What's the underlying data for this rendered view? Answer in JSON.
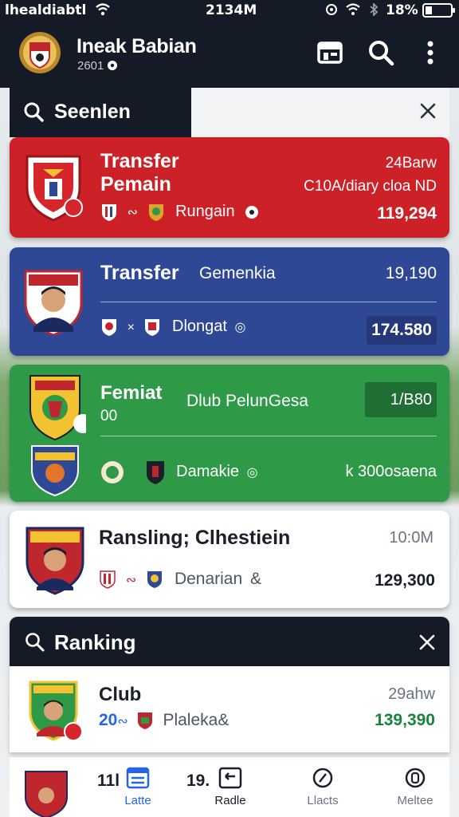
{
  "status": {
    "carrier": "lhealdiabtl",
    "time": "2134M",
    "battery": "18%"
  },
  "app": {
    "title": "Ineak Babian",
    "subtitle": "2601"
  },
  "search": {
    "label": "Seenlen"
  },
  "cards": {
    "red": {
      "title_line1": "Transfer",
      "title_line2": "Pemain",
      "badge": "24Barw",
      "info": "C10A/diary cloa ND",
      "player": "Rungain",
      "value": "119,294"
    },
    "blue": {
      "title": "Transfer",
      "subtitle": "Gemenkia",
      "top_value": "19,190",
      "player": "Dlongat",
      "value": "174.580"
    },
    "green": {
      "title": "Femiat",
      "subtitle": "Dlub PelunGesa",
      "small": "00",
      "top_value": "1/B80",
      "player": "Damakie",
      "value": "k 300osaena"
    },
    "white": {
      "title": "Ransling;  Clhestiein",
      "badge": "10:0M",
      "player": "Denarian",
      "value": "129,300"
    }
  },
  "ranking": {
    "label": "Ranking",
    "row": {
      "title": "Club",
      "rank": "20",
      "player": "Plaleka",
      "badge": "29ahw",
      "value": "139,390"
    }
  },
  "bottom_nav": {
    "partial_a": "11l",
    "partial_b": "19.",
    "items": [
      "Latte",
      "Radle",
      "Llacts",
      "Meltee"
    ]
  },
  "colors": {
    "dark": "#141a26",
    "red": "#cc2127",
    "blue": "#2f4896",
    "green": "#2e9a47",
    "value_green": "#17843a",
    "accent_blue": "#2563eb"
  }
}
